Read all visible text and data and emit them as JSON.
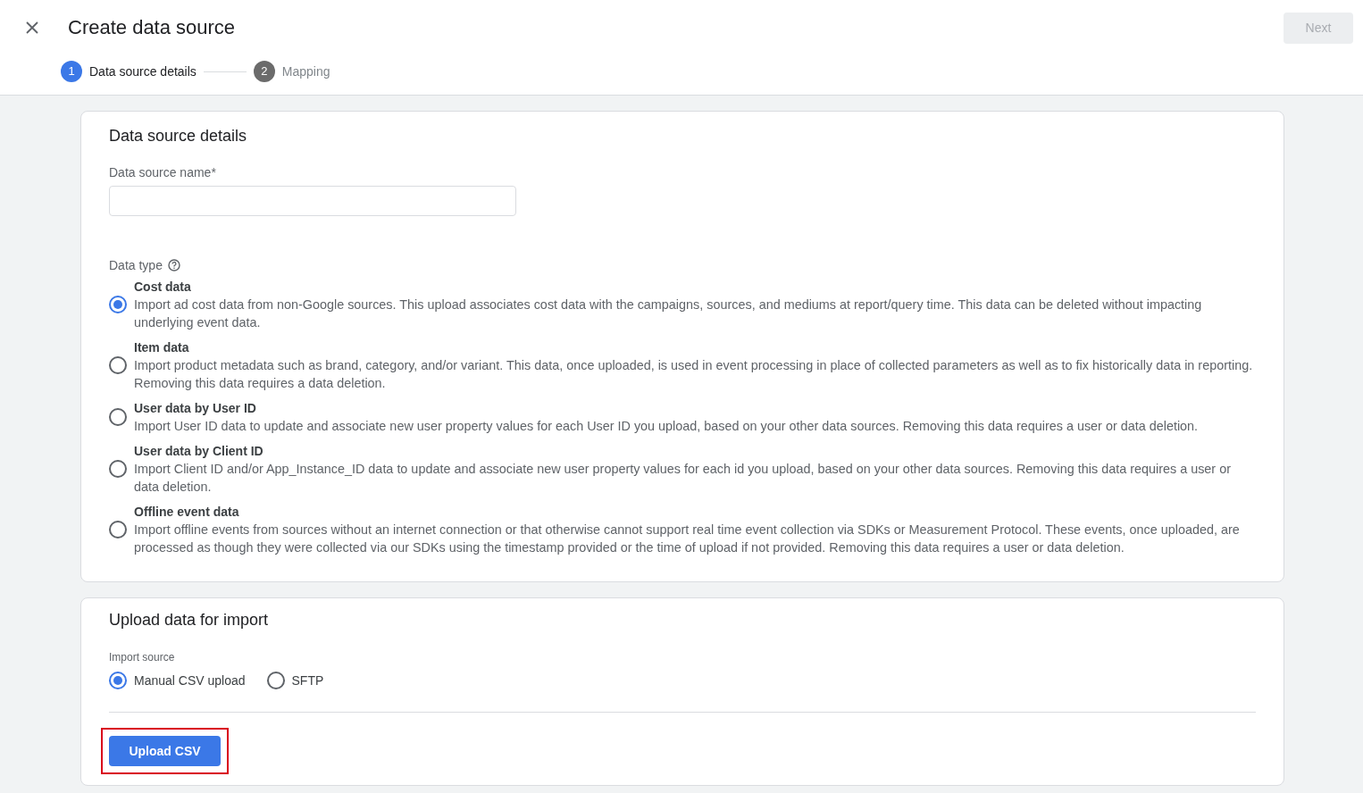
{
  "header": {
    "title": "Create data source",
    "next_button": {
      "label": "Next",
      "disabled": true
    }
  },
  "stepper": [
    {
      "number": "1",
      "label": "Data source details",
      "selected": true
    },
    {
      "number": "2",
      "label": "Mapping",
      "selected": false
    }
  ],
  "details_card": {
    "title": "Data source details",
    "name_field": {
      "label": "Data source name*"
    },
    "data_type": {
      "label": "Data type",
      "options": [
        {
          "title": "Cost data",
          "description": "Import ad cost data from non-Google sources. This upload associates cost data with the campaigns, sources, and mediums at report/query time. This data can be deleted without impacting underlying event data.",
          "selected": true
        },
        {
          "title": "Item data",
          "description": "Import product metadata such as brand, category, and/or variant. This data, once uploaded, is used in event processing in place of collected parameters as well as to fix historically data in reporting. Removing this data requires a data deletion.",
          "selected": false
        },
        {
          "title": "User data by User ID",
          "description": "Import User ID data to update and associate new user property values for each User ID you upload, based on your other data sources. Removing this data requires a user or data deletion.",
          "selected": false
        },
        {
          "title": "User data by Client ID",
          "description": "Import Client ID and/or App_Instance_ID data to update and associate new user property values for each id you upload, based on your other data sources. Removing this data requires a user or data deletion.",
          "selected": false
        },
        {
          "title": "Offline event data",
          "description": "Import offline events from sources without an internet connection or that otherwise cannot support real time event collection via SDKs or Measurement Protocol. These events, once uploaded, are processed as though they were collected via our SDKs using the timestamp provided or the time of upload if not provided. Removing this data requires a user or data deletion.",
          "selected": false
        }
      ]
    }
  },
  "upload_card": {
    "title": "Upload data for import",
    "import_source": {
      "label": "Import source",
      "options": [
        {
          "label": "Manual CSV upload",
          "selected": true
        },
        {
          "label": "SFTP",
          "selected": false
        }
      ]
    },
    "upload_button": {
      "label": "Upload CSV",
      "highlighted": true
    }
  }
}
